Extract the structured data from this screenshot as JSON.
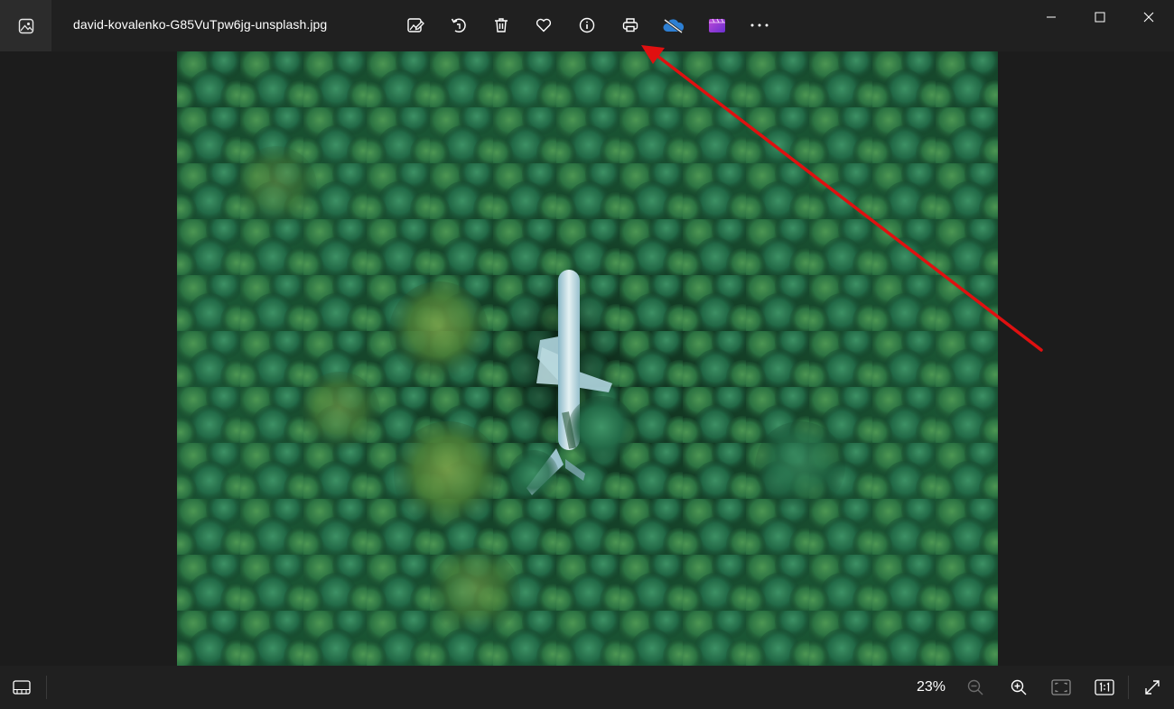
{
  "app": {
    "icon": "photos-app-icon",
    "file_name": "david-kovalenko-G85VuTpw6jg-unsplash.jpg"
  },
  "toolbar": {
    "items": [
      {
        "name": "edit-image",
        "icon": "edit-image-icon"
      },
      {
        "name": "rotate",
        "icon": "rotate-icon"
      },
      {
        "name": "delete",
        "icon": "trash-icon"
      },
      {
        "name": "favorite",
        "icon": "heart-icon"
      },
      {
        "name": "file-info",
        "icon": "info-icon"
      },
      {
        "name": "print",
        "icon": "printer-icon"
      },
      {
        "name": "onedrive",
        "icon": "onedrive-cloud-icon"
      },
      {
        "name": "clipchamp",
        "icon": "clipchamp-icon"
      },
      {
        "name": "see-more",
        "icon": "more-horizontal-icon"
      }
    ]
  },
  "window_controls": [
    "minimize-icon",
    "maximize-icon",
    "close-icon"
  ],
  "bottom_bar": {
    "zoom_level": "23%",
    "items": [
      "filmstrip-icon",
      "zoom-out-icon",
      "zoom-in-icon",
      "fit-to-window-icon",
      "actual-size-icon",
      "fullscreen-icon"
    ]
  },
  "colors": {
    "titlebar": "#202020",
    "background": "#1c1c1c",
    "arrow": "#e01010",
    "onedrive": "#2d7fd3",
    "clipchamp": "#8a3ad6"
  }
}
